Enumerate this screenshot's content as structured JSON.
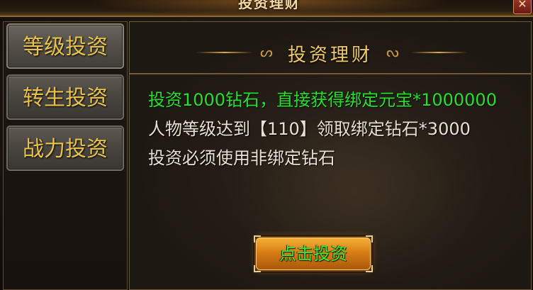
{
  "window": {
    "title": "投资理财",
    "close_glyph": "✕"
  },
  "sidebar": {
    "items": [
      {
        "label": "等级投资"
      },
      {
        "label": "转生投资"
      },
      {
        "label": "战力投资"
      }
    ]
  },
  "panel": {
    "title": "投资理财",
    "ornament_left": "ᔕ",
    "ornament_right": "ᔕ",
    "lines": [
      "投资1000钻石，直接获得绑定元宝*1000000",
      "人物等级达到【110】领取绑定钻石*3000",
      "投资必须使用非绑定钻石"
    ],
    "invest_button": "点击投资"
  },
  "colors": {
    "highlight_text": "#25e02b",
    "normal_text": "#e8e0d2",
    "tab_text": "#e8c24a",
    "button_fill": "#d87e16"
  }
}
